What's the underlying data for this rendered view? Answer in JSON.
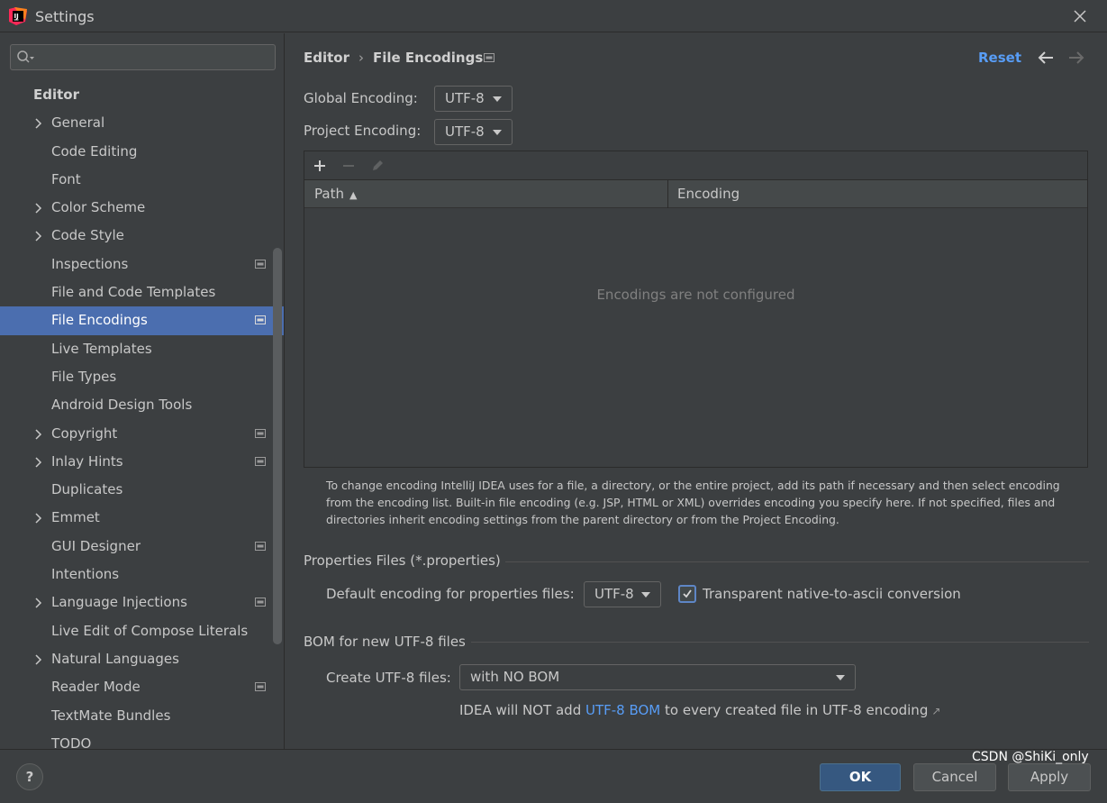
{
  "window": {
    "title": "Settings"
  },
  "sidebar": {
    "header": "Editor",
    "items": [
      {
        "label": "General",
        "expandable": true,
        "project": false
      },
      {
        "label": "Code Editing",
        "expandable": false,
        "project": false
      },
      {
        "label": "Font",
        "expandable": false,
        "project": false
      },
      {
        "label": "Color Scheme",
        "expandable": true,
        "project": false
      },
      {
        "label": "Code Style",
        "expandable": true,
        "project": false
      },
      {
        "label": "Inspections",
        "expandable": false,
        "project": true
      },
      {
        "label": "File and Code Templates",
        "expandable": false,
        "project": false
      },
      {
        "label": "File Encodings",
        "expandable": false,
        "project": true,
        "selected": true
      },
      {
        "label": "Live Templates",
        "expandable": false,
        "project": false
      },
      {
        "label": "File Types",
        "expandable": false,
        "project": false
      },
      {
        "label": "Android Design Tools",
        "expandable": false,
        "project": false
      },
      {
        "label": "Copyright",
        "expandable": true,
        "project": true
      },
      {
        "label": "Inlay Hints",
        "expandable": true,
        "project": true
      },
      {
        "label": "Duplicates",
        "expandable": false,
        "project": false
      },
      {
        "label": "Emmet",
        "expandable": true,
        "project": false
      },
      {
        "label": "GUI Designer",
        "expandable": false,
        "project": true
      },
      {
        "label": "Intentions",
        "expandable": false,
        "project": false
      },
      {
        "label": "Language Injections",
        "expandable": true,
        "project": true
      },
      {
        "label": "Live Edit of Compose Literals",
        "expandable": false,
        "project": false
      },
      {
        "label": "Natural Languages",
        "expandable": true,
        "project": false
      },
      {
        "label": "Reader Mode",
        "expandable": false,
        "project": true
      },
      {
        "label": "TextMate Bundles",
        "expandable": false,
        "project": false
      },
      {
        "label": "TODO",
        "expandable": false,
        "project": false
      }
    ]
  },
  "breadcrumb": {
    "parent": "Editor",
    "separator": "›",
    "current": "File Encodings"
  },
  "reset_label": "Reset",
  "global_encoding": {
    "label": "Global Encoding:",
    "value": "UTF-8"
  },
  "project_encoding": {
    "label": "Project Encoding:",
    "value": "UTF-8"
  },
  "table": {
    "columns": [
      "Path",
      "Encoding"
    ],
    "sort_indicator": "▲",
    "empty_text": "Encodings are not configured"
  },
  "help_text": "To change encoding IntelliJ IDEA uses for a file, a directory, or the entire project, add its path if necessary and then select encoding from the encoding list. Built-in file encoding (e.g. JSP, HTML or XML) overrides encoding you specify here. If not specified, files and directories inherit encoding settings from the parent directory or from the Project Encoding.",
  "properties": {
    "section_title": "Properties Files (*.properties)",
    "default_label": "Default encoding for properties files:",
    "default_value": "UTF-8",
    "checkbox_label": "Transparent native-to-ascii conversion",
    "checkbox_checked": true
  },
  "bom": {
    "section_title": "BOM for new UTF-8 files",
    "create_label": "Create UTF-8 files:",
    "create_value": "with NO BOM",
    "note_prefix": "IDEA will NOT add ",
    "note_link": "UTF-8 BOM",
    "note_suffix": " to every created file in UTF-8 encoding",
    "note_ext": "↗"
  },
  "footer": {
    "help": "?",
    "ok": "OK",
    "cancel": "Cancel",
    "apply": "Apply"
  },
  "watermark": "CSDN @ShiKi_only",
  "colors": {
    "selection": "#4b6eaf",
    "link": "#589df6",
    "ok_button": "#365880",
    "background": "#3c3f41"
  }
}
